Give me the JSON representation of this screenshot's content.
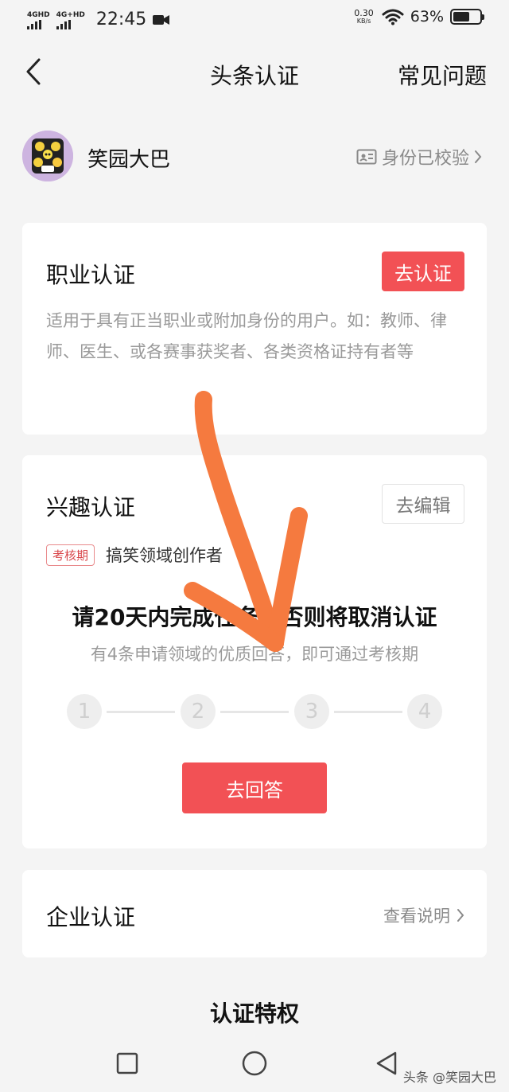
{
  "status_bar": {
    "signal1_label": "4GHD",
    "signal2_label": "4G+HD",
    "time": "22:45",
    "speed_value": "0.30",
    "speed_unit": "KB/s",
    "battery_percent": "63%",
    "battery_level": 0.63
  },
  "nav": {
    "title": "头条认证",
    "faq": "常见问题"
  },
  "profile": {
    "username": "笑园大巴",
    "identity_status": "身份已校验"
  },
  "professional": {
    "title": "职业认证",
    "button": "去认证",
    "description": "适用于具有正当职业或附加身份的用户。如：教师、律师、医生、或各赛事获奖者、各类资格证持有者等"
  },
  "interest": {
    "title": "兴趣认证",
    "button": "去编辑",
    "tag": "考核期",
    "field": "搞笑领域创作者",
    "task_title": "请20天内完成任务，否则将取消认证",
    "task_desc": "有4条申请领域的优质回答，即可通过考核期",
    "steps": [
      "1",
      "2",
      "3",
      "4"
    ],
    "answer_button": "去回答"
  },
  "enterprise": {
    "title": "企业认证",
    "link": "查看说明"
  },
  "privileges_title": "认证特权",
  "watermark": "头条 @笑园大巴",
  "colors": {
    "accent": "#f25155",
    "annotation_arrow": "#f57a3f"
  }
}
